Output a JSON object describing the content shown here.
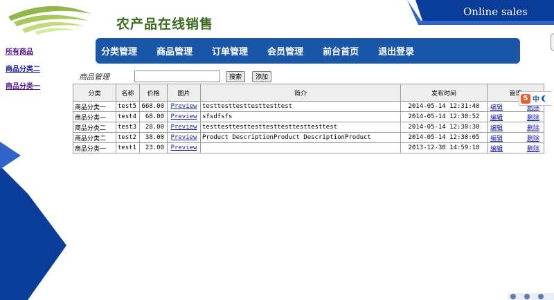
{
  "header": {
    "site_title": "农产品在线销售",
    "online_sales": "Online sales"
  },
  "side_nav": [
    "所有商品",
    "商品分类二",
    "商品分类一"
  ],
  "nav_bar": [
    "分类管理",
    "商品管理",
    "订单管理",
    "会员管理",
    "前台首页",
    "退出登录"
  ],
  "toolbar": {
    "title": "商品管理",
    "search_value": "",
    "search_label": "搜索",
    "add_label": "添加"
  },
  "table": {
    "columns": [
      "分类",
      "名称",
      "价格",
      "图片",
      "简介",
      "发布时间",
      "管理"
    ],
    "rows": [
      {
        "category": "商品分类一",
        "name": "test5",
        "price": "668.00",
        "image": "Preview",
        "intro": "testtesttesttesttesttest",
        "time": "2014-05-14 12:31:40",
        "edit": "编辑",
        "delete": "删除"
      },
      {
        "category": "商品分类一",
        "name": "test4",
        "price": "68.00",
        "image": "Preview",
        "intro": "sfsdfsfs",
        "time": "2014-05-14 12:30:52",
        "edit": "编辑",
        "delete": "删除"
      },
      {
        "category": "商品分类二",
        "name": "test3",
        "price": "28.00",
        "image": "Preview",
        "intro": "testtesttesttesttesttesttesttesttest",
        "time": "2014-05-14 12:30:30",
        "edit": "编辑",
        "delete": "删除"
      },
      {
        "category": "商品分类二",
        "name": "test2",
        "price": "38.00",
        "image": "Preview",
        "intro": "Product DescriptionProduct DescriptionProduct",
        "time": "2014-05-14 12:30:05",
        "edit": "编辑",
        "delete": "删除"
      },
      {
        "category": "商品分类一",
        "name": "test1",
        "price": "23.00",
        "image": "Preview",
        "intro": "",
        "time": "2013-12-30 14:59:18",
        "edit": "编辑",
        "delete": "删除"
      }
    ]
  },
  "ime": {
    "logo": "S",
    "lang": "中"
  },
  "colors": {
    "brand_blue": "#0a3c9a",
    "nav_blue": "#1a57a8",
    "title_green": "#3a6b1e"
  }
}
